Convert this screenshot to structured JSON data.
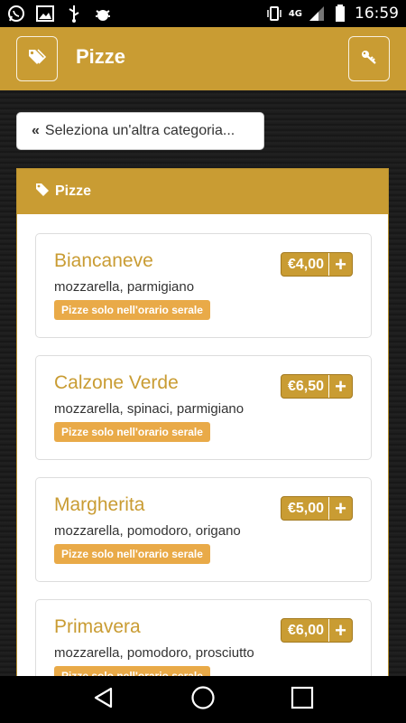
{
  "status": {
    "time": "16:59",
    "network": "4G"
  },
  "app_bar": {
    "title": "Pizze"
  },
  "back_button": {
    "label": "Seleziona un'altra categoria..."
  },
  "panel": {
    "header": "Pizze"
  },
  "items": [
    {
      "name": "Biancaneve",
      "description": "mozzarella, parmigiano",
      "badge": "Pizze solo nell'orario serale",
      "price": "€4,00"
    },
    {
      "name": "Calzone Verde",
      "description": "mozzarella, spinaci, parmigiano",
      "badge": "Pizze solo nell'orario serale",
      "price": "€6,50"
    },
    {
      "name": "Margherita",
      "description": "mozzarella, pomodoro, origano",
      "badge": "Pizze solo nell'orario serale",
      "price": "€5,00"
    },
    {
      "name": "Primavera",
      "description": "mozzarella, pomodoro, prosciutto",
      "badge": "Pizze solo nell'orario serale",
      "price": "€6,00"
    }
  ],
  "colors": {
    "accent": "#c99c33",
    "badge": "#e9aa48"
  },
  "icons": {
    "app_bar_left": "tags-icon",
    "app_bar_right": "key-icon",
    "panel_header": "tag-icon"
  }
}
